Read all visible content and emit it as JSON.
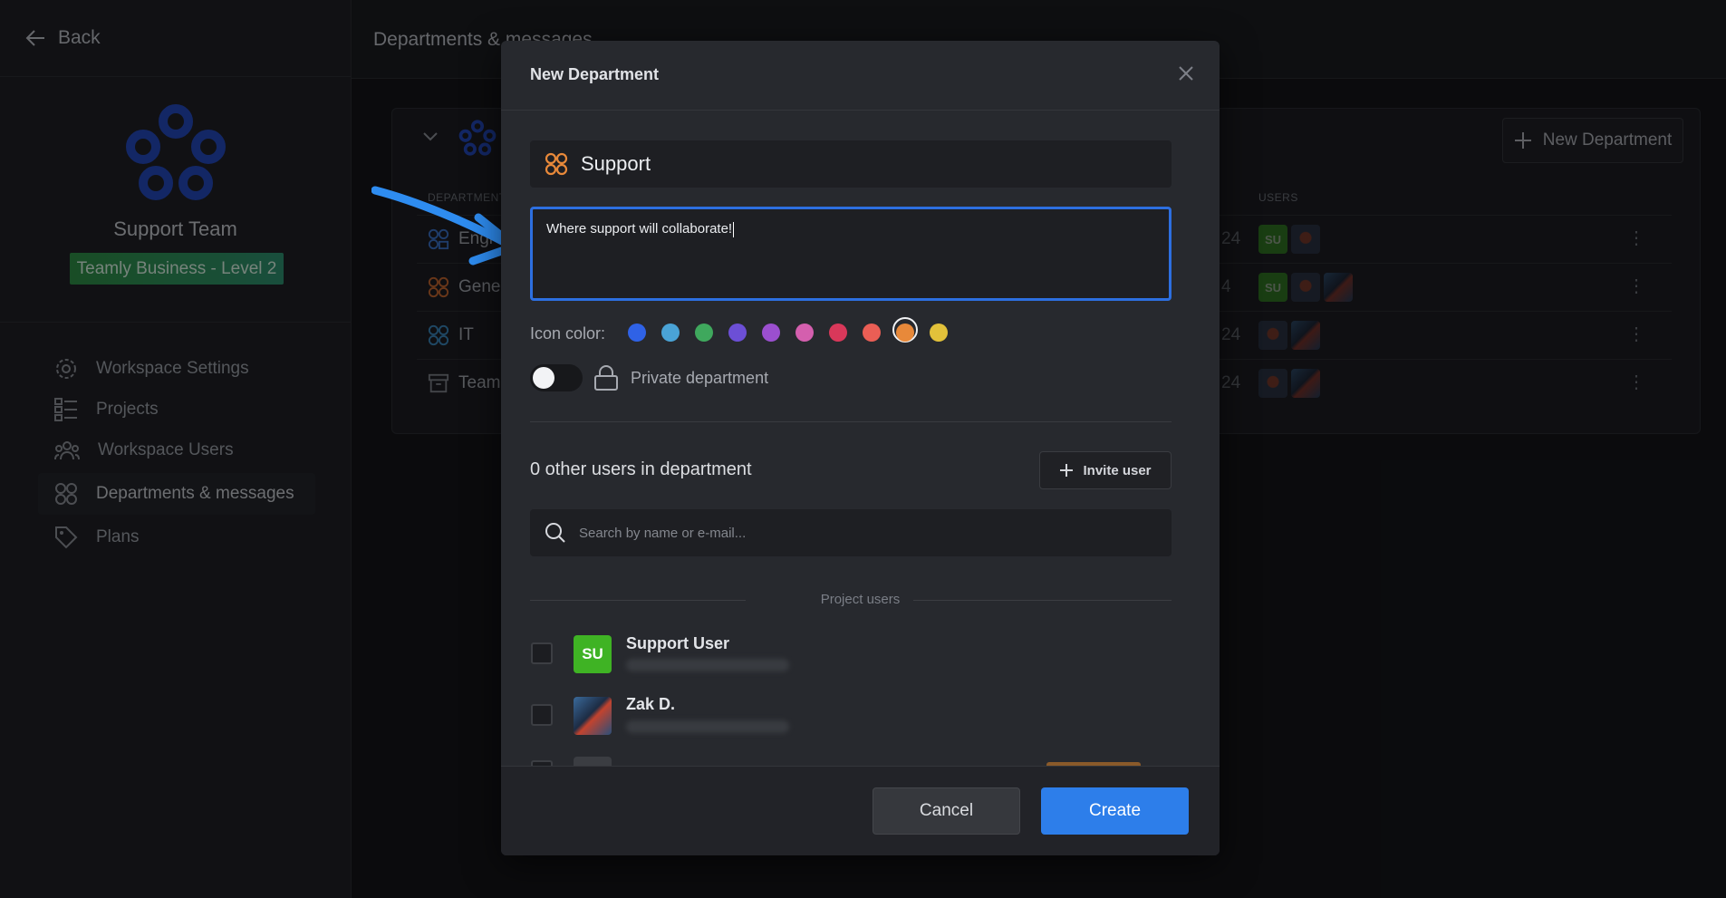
{
  "sidebar": {
    "back_label": "Back",
    "team_name": "Support Team",
    "plan_badge": "Teamly Business - Level 2",
    "items": [
      {
        "label": "Workspace Settings"
      },
      {
        "label": "Projects"
      },
      {
        "label": "Workspace Users"
      },
      {
        "label": "Departments & messages"
      },
      {
        "label": "Plans"
      }
    ]
  },
  "main": {
    "title": "Departments & messages",
    "new_department_label": "New Department",
    "columns": {
      "department": "DEPARTMENT",
      "users": "USERS"
    },
    "rows": [
      {
        "name": "Engi",
        "date": "24"
      },
      {
        "name": "Gene",
        "date": "4"
      },
      {
        "name": "IT",
        "date": "24"
      },
      {
        "name": "Team",
        "date": "24"
      }
    ],
    "avatar_initials": "SU"
  },
  "modal": {
    "title": "New Department",
    "name_value": "Support",
    "description_value": "Where support will collaborate!",
    "icon_color_label": "Icon color:",
    "icon_colors": [
      "#2f62e6",
      "#4aa3d6",
      "#3fa85d",
      "#6c4fd6",
      "#9b4fcf",
      "#d45fae",
      "#d9385a",
      "#ea5e55",
      "#e8893a",
      "#e2c13a"
    ],
    "selected_color": "#e8893a",
    "private_label": "Private department",
    "private_enabled": false,
    "users_count_label": "0 other users in department",
    "invite_label": "Invite user",
    "search_placeholder": "Search by name or e-mail...",
    "project_users_label": "Project users",
    "users": [
      {
        "name": "Support User",
        "initials": "SU"
      },
      {
        "name": "Zak D."
      }
    ],
    "cancel_label": "Cancel",
    "create_label": "Create"
  }
}
